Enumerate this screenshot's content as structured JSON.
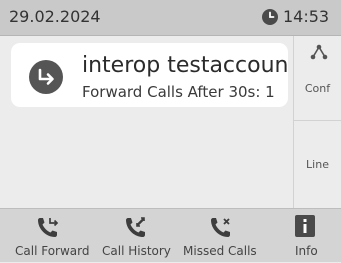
{
  "status_bar": {
    "date": "29.02.2024",
    "time": "14:53",
    "clock_icon": "clock-icon"
  },
  "call": {
    "name": "interop testaccount",
    "status": "Forward Calls After 30s: 1",
    "icon": "call-forward-icon",
    "accent": "#555555"
  },
  "side_panel": {
    "conf_label": "Conf",
    "line_label": "Line",
    "conf_icon": "conference-icon"
  },
  "softkeys": [
    {
      "label": "Call Forward",
      "icon": "call-forward-icon"
    },
    {
      "label": "Call History",
      "icon": "call-history-icon"
    },
    {
      "label": "Missed Calls",
      "icon": "missed-calls-icon"
    },
    {
      "label": "Info",
      "icon": "info-icon"
    }
  ]
}
